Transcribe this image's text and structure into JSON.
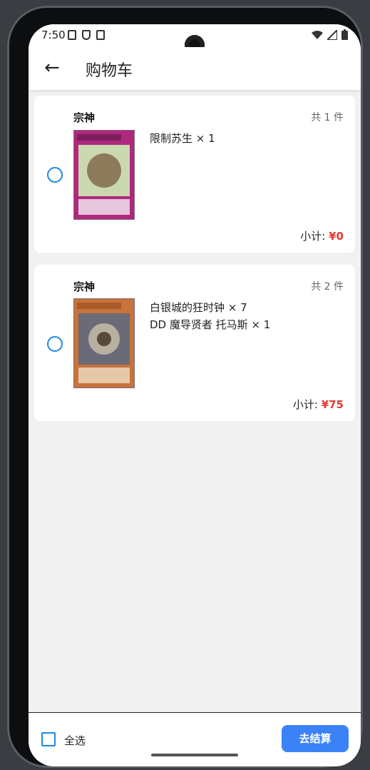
{
  "status": {
    "time": "7:50"
  },
  "header": {
    "title": "购物车"
  },
  "orders": [
    {
      "shop": "宗神",
      "count": "共 1 件",
      "items": [
        "限制苏生 × 1"
      ],
      "subtotal_label": "小计:",
      "subtotal_price": "¥0"
    },
    {
      "shop": "宗神",
      "count": "共 2 件",
      "items": [
        "白银城的狂时钟 × 7",
        "DD 魔导贤者 托马斯 × 1"
      ],
      "subtotal_label": "小计:",
      "subtotal_price": "¥75"
    }
  ],
  "footer": {
    "select_all": "全选",
    "checkout": "去结算"
  },
  "colors": {
    "accent": "#3b82f6",
    "price": "#e53935",
    "radio": "#1e88e5"
  }
}
